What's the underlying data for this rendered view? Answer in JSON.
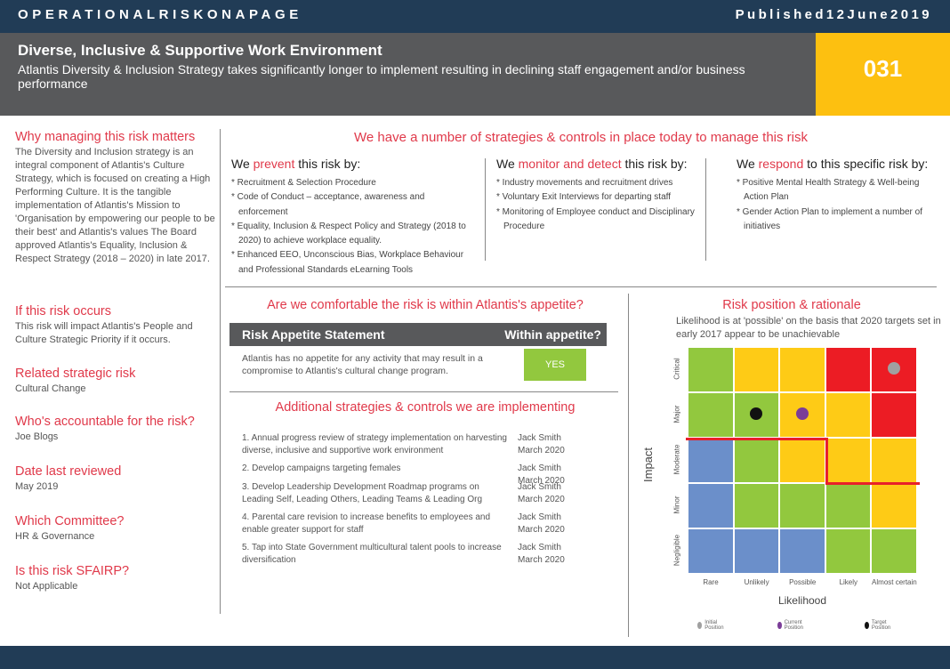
{
  "header": {
    "left": "OPERATIONALRISKONAPAGE",
    "right": "Published12June2019"
  },
  "risk": {
    "title": "Diverse, Inclusive & Supportive Work Environment",
    "description": "Atlantis Diversity & Inclusion Strategy takes significantly longer to implement resulting in declining staff engagement and/or business performance",
    "number": "031"
  },
  "sidebar": [
    {
      "heading": "Why managing this risk matters",
      "text": "The Diversity and Inclusion strategy is an integral component of Atlantis's Culture Strategy, which is focused on creating a High Performing Culture. It is the tangible implementation of Atlantis's Mission to 'Organisation by empowering our people to be their best' and Atlantis's values The Board approved Atlantis's Equality, Inclusion & Respect Strategy (2018 – 2020) in late 2017."
    },
    {
      "heading": "If this risk occurs",
      "text": "This risk will impact Atlantis's People and Culture Strategic Priority if it occurs."
    },
    {
      "heading": "Related strategic risk",
      "text": "Cultural Change"
    },
    {
      "heading": "Who's accountable for the risk?",
      "text": "Joe Blogs"
    },
    {
      "heading": "Date last reviewed",
      "text": "May 2019"
    },
    {
      "heading": "Which Committee?",
      "text": "HR & Governance"
    },
    {
      "heading": "Is this risk SFAIRP?",
      "text": "Not Applicable"
    }
  ],
  "controls": {
    "heading": "We have a number of strategies & controls in place today to manage this risk",
    "columns": [
      {
        "pre": "We ",
        "accent": "prevent",
        "post": " this risk by:",
        "items": [
          "Recruitment & Selection Procedure",
          "Code of Conduct – acceptance, awareness and enforcement",
          "Equality, Inclusion & Respect Policy and Strategy (2018 to 2020) to achieve workplace equality.",
          "Enhanced EEO, Unconscious Bias, Workplace Behaviour and Professional Standards eLearning Tools"
        ]
      },
      {
        "pre": "We ",
        "accent": "monitor and detect",
        "post": " this risk by:",
        "items": [
          "Industry movements and recruitment drives",
          "Voluntary Exit Interviews for departing staff",
          "Monitoring of Employee conduct and Disciplinary Procedure"
        ]
      },
      {
        "pre": "We ",
        "accent": "respond",
        "post": " to this specific risk by:",
        "items": [
          "Positive Mental Health Strategy & Well-being Action Plan",
          "Gender Action Plan to implement a number of initiatives"
        ]
      }
    ]
  },
  "appetite": {
    "heading": "Are we comfortable the risk is within Atlantis's appetite?",
    "statement_label": "Risk Appetite Statement",
    "within_label": "Within appetite?",
    "statement": "Atlantis has no appetite for any activity that may result in a compromise to Atlantis's cultural change program.",
    "within_value": "YES"
  },
  "additional": {
    "heading": "Additional strategies & controls we are implementing",
    "items": [
      {
        "text": "1. Annual progress review of strategy implementation on harvesting diverse, inclusive and supportive work environment",
        "owner": "Jack Smith",
        "date": "March 2020"
      },
      {
        "text": "2. Develop campaigns targeting females",
        "owner": "Jack Smith",
        "date": "March 2020"
      },
      {
        "text": "3. Develop Leadership Development Roadmap programs on Leading Self, Leading Others, Leading Teams & Leading Org",
        "owner": "Jack Smith",
        "date": "March 2020"
      },
      {
        "text": "4. Parental care revision to increase benefits to employees and enable greater support for staff",
        "owner": "Jack Smith",
        "date": "March 2020"
      },
      {
        "text": "5. Tap into State Government multicultural talent pools to increase diversification",
        "owner": "Jack Smith",
        "date": "March 2020"
      }
    ]
  },
  "matrix": {
    "heading": "Risk position & rationale",
    "rationale": "Likelihood is at 'possible' on the basis that 2020 targets set in early 2017 appear to be unachievable",
    "xlabel": "Likelihood",
    "ylabel": "Impact",
    "likelihood": [
      "Rare",
      "Unlikely",
      "Possible",
      "Likely",
      "Almost certain"
    ],
    "impact": [
      "Critical",
      "Major",
      "Moderate",
      "Minor",
      "Negligible"
    ],
    "grid": [
      [
        "G",
        "Y",
        "Y",
        "R",
        "R"
      ],
      [
        "G",
        "G",
        "Y",
        "Y",
        "R"
      ],
      [
        "B",
        "G",
        "Y",
        "Y",
        "Y"
      ],
      [
        "B",
        "G",
        "G",
        "G",
        "Y"
      ],
      [
        "B",
        "B",
        "B",
        "G",
        "G"
      ]
    ],
    "colors": {
      "G": "#92c83e",
      "Y": "#fecb16",
      "R": "#ec1c24",
      "B": "#6b8fca",
      "line": "#e8202a"
    },
    "positions": [
      {
        "name": "Initial Position",
        "likelihood": "Almost certain",
        "impact": "Critical",
        "color": "#a0a0a0"
      },
      {
        "name": "Current Position",
        "likelihood": "Possible",
        "impact": "Major",
        "color": "#7b3d98"
      },
      {
        "name": "Target Position",
        "likelihood": "Unlikely",
        "impact": "Major",
        "color": "#111111"
      }
    ]
  }
}
